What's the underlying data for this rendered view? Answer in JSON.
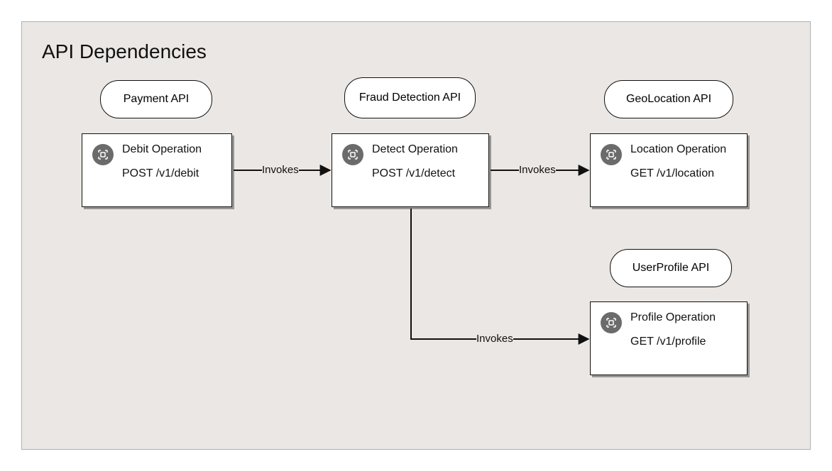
{
  "title": "API Dependencies",
  "apis": {
    "payment": {
      "label": "Payment API"
    },
    "fraud": {
      "label": "Fraud Detection API"
    },
    "geo": {
      "label": "GeoLocation API"
    },
    "profile": {
      "label": "UserProfile API"
    }
  },
  "operations": {
    "debit": {
      "title": "Debit Operation",
      "path": "POST /v1/debit"
    },
    "detect": {
      "title": "Detect Operation",
      "path": "POST /v1/detect"
    },
    "location": {
      "title": "Location Operation",
      "path": "GET /v1/location"
    },
    "profile": {
      "title": "Profile Operation",
      "path": "GET /v1/profile"
    }
  },
  "edges": {
    "e1": {
      "label": "Invokes"
    },
    "e2": {
      "label": "Invokes"
    },
    "e3": {
      "label": "Invokes"
    }
  },
  "chart_data": {
    "type": "diagram",
    "title": "API Dependencies",
    "nodes": [
      {
        "id": "payment_api",
        "type": "api",
        "label": "Payment API"
      },
      {
        "id": "fraud_api",
        "type": "api",
        "label": "Fraud Detection API"
      },
      {
        "id": "geo_api",
        "type": "api",
        "label": "GeoLocation API"
      },
      {
        "id": "profile_api",
        "type": "api",
        "label": "UserProfile API"
      },
      {
        "id": "debit_op",
        "type": "operation",
        "api": "payment_api",
        "title": "Debit Operation",
        "method": "POST",
        "path": "/v1/debit"
      },
      {
        "id": "detect_op",
        "type": "operation",
        "api": "fraud_api",
        "title": "Detect Operation",
        "method": "POST",
        "path": "/v1/detect"
      },
      {
        "id": "location_op",
        "type": "operation",
        "api": "geo_api",
        "title": "Location Operation",
        "method": "GET",
        "path": "/v1/location"
      },
      {
        "id": "profile_op",
        "type": "operation",
        "api": "profile_api",
        "title": "Profile Operation",
        "method": "GET",
        "path": "/v1/profile"
      }
    ],
    "edges": [
      {
        "from": "debit_op",
        "to": "detect_op",
        "label": "Invokes"
      },
      {
        "from": "detect_op",
        "to": "location_op",
        "label": "Invokes"
      },
      {
        "from": "detect_op",
        "to": "profile_op",
        "label": "Invokes"
      }
    ]
  }
}
